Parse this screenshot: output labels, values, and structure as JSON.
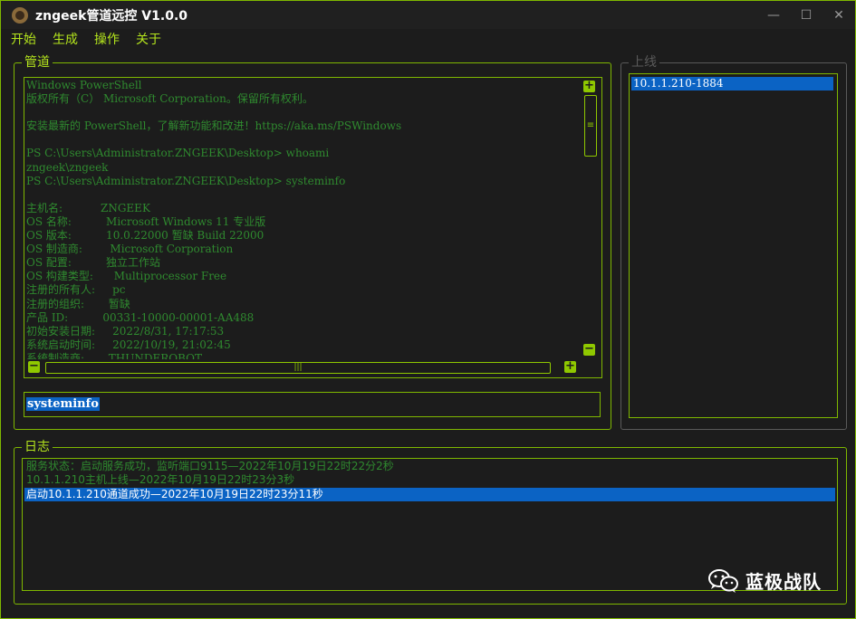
{
  "window": {
    "title": "zngeek管道远控 V1.0.0",
    "controls": {
      "minimize": "—",
      "maximize": "☐",
      "close": "✕"
    }
  },
  "menu": {
    "items": [
      "开始",
      "生成",
      "操作",
      "关于"
    ]
  },
  "pipe_panel": {
    "label": "管道",
    "console_lines": [
      "Windows PowerShell",
      "版权所有（C） Microsoft Corporation。保留所有权利。",
      "",
      "安装最新的 PowerShell，了解新功能和改进！https://aka.ms/PSWindows",
      "",
      "PS C:\\Users\\Administrator.ZNGEEK\\Desktop> whoami",
      "zngeek\\zngeek",
      "PS C:\\Users\\Administrator.ZNGEEK\\Desktop> systeminfo",
      "",
      "主机名:           ZNGEEK",
      "OS 名称:          Microsoft Windows 11 专业版",
      "OS 版本:          10.0.22000 暂缺 Build 22000",
      "OS 制造商:        Microsoft Corporation",
      "OS 配置:          独立工作站",
      "OS 构建类型:      Multiprocessor Free",
      "注册的所有人:     pc",
      "注册的组织:       暂缺",
      "产品 ID:          00331-10000-00001-AA488",
      "初始安装日期:     2022/8/31, 17:17:53",
      "系统启动时间:     2022/10/19, 21:02:45",
      "系统制造商:       THUNDEROBOT"
    ],
    "scrollbar": {
      "up": "+",
      "down": "−",
      "left": "−",
      "right": "+",
      "v_grip": "≡",
      "h_grip": "|||"
    },
    "command_input": "systeminfo"
  },
  "online_panel": {
    "label": "上线",
    "items": [
      "10.1.1.210-1884"
    ]
  },
  "log_panel": {
    "label": "日志",
    "lines": [
      "服务状态：启动服务成功，监听端口9115—2022年10月19日22时22分2秒",
      "10.1.1.210主机上线—2022年10月19日22时23分3秒",
      "启动10.1.1.210通道成功—2022年10月19日22时23分11秒"
    ]
  },
  "watermark": {
    "text": "蓝极战队",
    "icon": "wechat-icon"
  },
  "colors": {
    "accent": "#7fb800",
    "menu_text": "#b5e61d",
    "console_text": "#2f8a2f",
    "selection": "#0b63c4",
    "background": "#1c1c1c"
  }
}
